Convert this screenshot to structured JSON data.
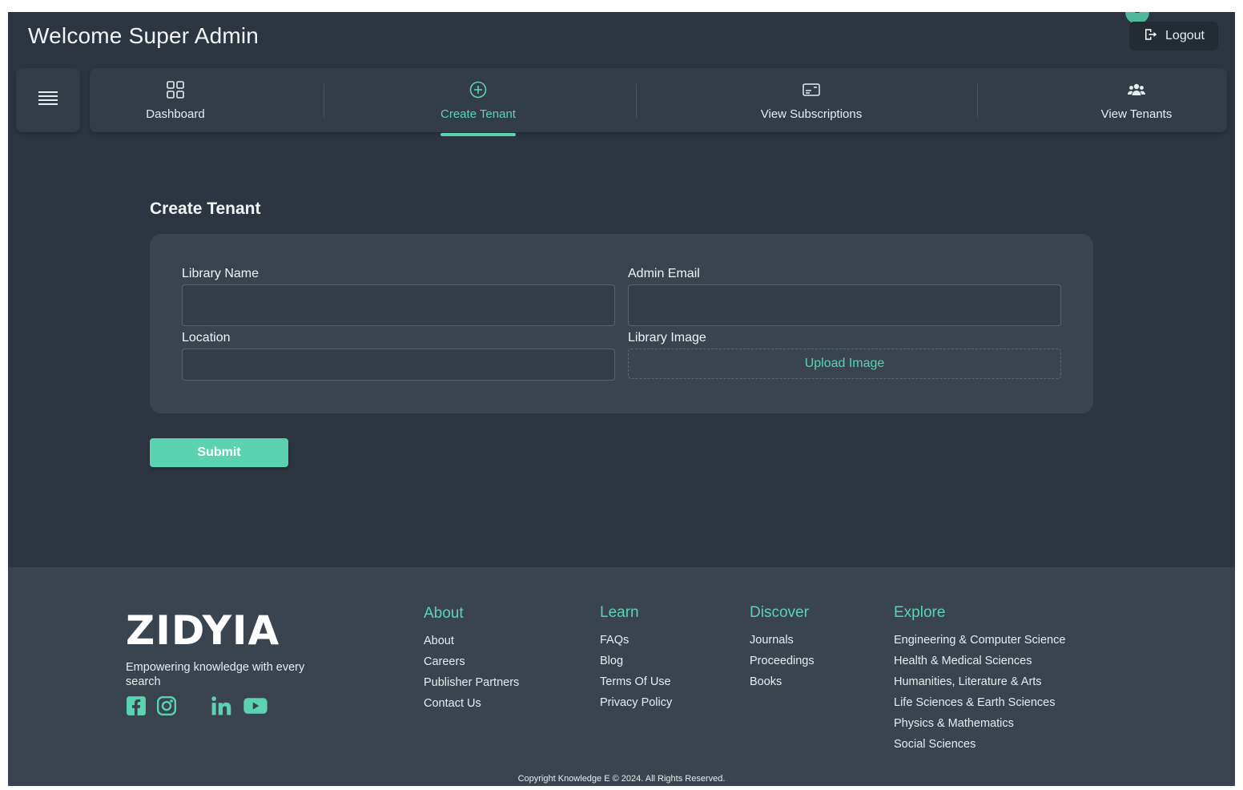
{
  "header": {
    "welcome": "Welcome Super Admin",
    "logout_label": "Logout"
  },
  "nav": {
    "items": [
      {
        "label": "Dashboard",
        "icon": "grid-icon"
      },
      {
        "label": "Create Tenant",
        "icon": "plus-circle-icon",
        "active": true
      },
      {
        "label": "View Subscriptions",
        "icon": "card-icon"
      },
      {
        "label": "View Tenants",
        "icon": "users-icon"
      }
    ]
  },
  "form": {
    "title": "Create Tenant",
    "library_name_label": "Library Name",
    "library_name_value": "",
    "admin_email_label": "Admin Email",
    "admin_email_value": "",
    "location_label": "Location",
    "location_value": "",
    "library_image_label": "Library Image",
    "upload_label": "Upload Image",
    "submit_label": "Submit"
  },
  "footer": {
    "logo": "ZIDYIA",
    "tagline": "Empowering knowledge with every search",
    "social": [
      "facebook-icon",
      "instagram-icon",
      "linkedin-icon",
      "youtube-icon"
    ],
    "columns": [
      {
        "heading": "About",
        "links": [
          "About",
          "Careers",
          "Publisher Partners",
          "Contact Us"
        ]
      },
      {
        "heading": "Learn",
        "links": [
          "FAQs",
          "Blog",
          "Terms Of Use",
          "Privacy Policy"
        ]
      },
      {
        "heading": "Discover",
        "links": [
          "Journals",
          "Proceedings",
          "Books"
        ]
      },
      {
        "heading": "Explore",
        "links": [
          "Engineering & Computer Science",
          "Health & Medical Sciences",
          "Humanities, Literature & Arts",
          "Life Sciences & Earth Sciences",
          "Physics & Mathematics",
          "Social Sciences"
        ]
      }
    ],
    "copyright": "Copyright Knowledge E © 2024. All Rights Reserved."
  },
  "colors": {
    "accent": "#5cd3b0",
    "background": "#2d3640",
    "card": "#39444f"
  }
}
